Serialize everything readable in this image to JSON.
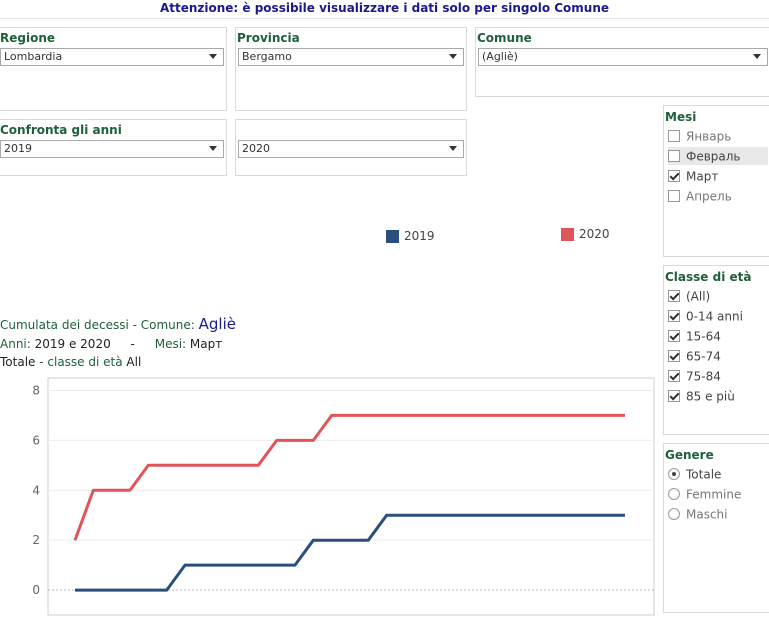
{
  "banner": "Attenzione: è possibile visualizzare i dati solo per singolo Comune",
  "regione": {
    "title": "Regione",
    "value": "Lombardia"
  },
  "provincia": {
    "title": "Provincia",
    "value": "Bergamo"
  },
  "comune": {
    "title": "Comune",
    "value": "(Agliè)"
  },
  "confronta": {
    "title": "Confronta gli anni",
    "year1": "2019",
    "year2": "2020"
  },
  "mesi": {
    "title": "Mesi",
    "items": [
      {
        "label": "Январь",
        "checked": false
      },
      {
        "label": "Февраль",
        "checked": false
      },
      {
        "label": "Март",
        "checked": true
      },
      {
        "label": "Апрель",
        "checked": false
      }
    ]
  },
  "classe": {
    "title": "Classe di età",
    "items": [
      {
        "label": "(All)",
        "checked": true
      },
      {
        "label": "0-14 anni",
        "checked": true
      },
      {
        "label": "15-64",
        "checked": true
      },
      {
        "label": "65-74",
        "checked": true
      },
      {
        "label": "75-84",
        "checked": true
      },
      {
        "label": "85 e più",
        "checked": true
      }
    ]
  },
  "genere": {
    "title": "Genere",
    "items": [
      {
        "label": "Totale",
        "selected": true
      },
      {
        "label": "Femmine",
        "selected": false
      },
      {
        "label": "Maschi",
        "selected": false
      }
    ]
  },
  "legend": [
    {
      "label": "2019",
      "color": "#2b4f7d"
    },
    {
      "label": "2020",
      "color": "#e05559"
    }
  ],
  "info": {
    "line1_prefix": "Cumulata dei decessi -  Comune:",
    "line1_comune": "Agliè",
    "line2_label1": "Anni:",
    "line2_value1": "2019 e 2020",
    "line2_sep": "-",
    "line2_label2": "Mesi:",
    "line2_value2": "Март",
    "line3_label1": "Totale",
    "line3_label2": "- classe di età",
    "line3_value": "All"
  },
  "chart_data": {
    "type": "line",
    "x": [
      1,
      2,
      3,
      4,
      5,
      6,
      7,
      8,
      9,
      10,
      11,
      12,
      13,
      14,
      15,
      16,
      17,
      18,
      19,
      20,
      21,
      22,
      23,
      24,
      25,
      26,
      27,
      28,
      29,
      30,
      31
    ],
    "series": [
      {
        "name": "2019",
        "color": "#2b4f7d",
        "values": [
          0,
          0,
          0,
          0,
          0,
          0,
          1,
          1,
          1,
          1,
          1,
          1,
          1,
          2,
          2,
          2,
          2,
          3,
          3,
          3,
          3,
          3,
          3,
          3,
          3,
          3,
          3,
          3,
          3,
          3,
          3
        ]
      },
      {
        "name": "2020",
        "color": "#e05559",
        "values": [
          2,
          4,
          4,
          4,
          5,
          5,
          5,
          5,
          5,
          5,
          5,
          6,
          6,
          6,
          7,
          7,
          7,
          7,
          7,
          7,
          7,
          7,
          7,
          7,
          7,
          7,
          7,
          7,
          7,
          7,
          7
        ]
      }
    ],
    "yticks": [
      0,
      2,
      4,
      6,
      8
    ],
    "ylim": [
      -1,
      8.5
    ],
    "grid": true
  }
}
